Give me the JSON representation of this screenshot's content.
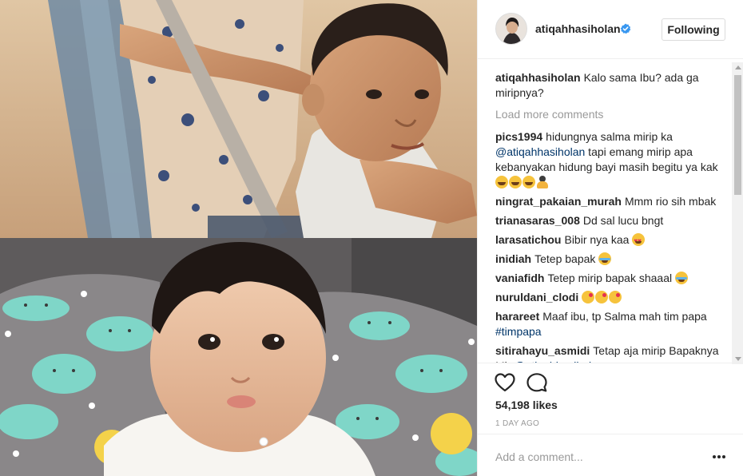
{
  "post": {
    "author": "atiqahhasiholan",
    "follow_label": "Following",
    "caption": "Kalo sama Ibu? ada ga miripnya?",
    "load_more_label": "Load more comments",
    "likes": "54,198 likes",
    "time": "1 DAY AGO",
    "comment_placeholder": "Add a comment..."
  },
  "comments": [
    {
      "user": "pics1994",
      "parts": [
        {
          "t": "hidungnya salma mirip ka "
        },
        {
          "t": "@atiqahhasiholan",
          "m": true
        },
        {
          "t": " tapi emang mirip apa kebanyakan hidung bayi masih begitu ya kak "
        }
      ],
      "emoji": [
        "laugh",
        "laugh",
        "laugh",
        "pray"
      ]
    },
    {
      "user": "ningrat_pakaian_murah",
      "parts": [
        {
          "t": "Mmm rio sih mbak"
        }
      ],
      "emoji": []
    },
    {
      "user": "trianasaras_008",
      "parts": [
        {
          "t": "Dd sal lucu bngt"
        }
      ],
      "emoji": []
    },
    {
      "user": "larasatichou",
      "parts": [
        {
          "t": "Bibir nya kaa "
        }
      ],
      "emoji": [
        "heart-eyes"
      ]
    },
    {
      "user": "inidiah",
      "parts": [
        {
          "t": "Tetep bapak "
        }
      ],
      "emoji": [
        "grin-tears"
      ]
    },
    {
      "user": "vaniafidh",
      "parts": [
        {
          "t": "Tetep mirip bapak shaaal "
        }
      ],
      "emoji": [
        "grin-tears"
      ]
    },
    {
      "user": "nuruldani_clodi",
      "parts": [
        {
          "t": ""
        }
      ],
      "emoji": [
        "kiss",
        "kiss",
        "kiss"
      ]
    },
    {
      "user": "harareet",
      "parts": [
        {
          "t": "Maaf ibu, tp Salma mah tim papa "
        },
        {
          "t": "#timpapa",
          "m": true
        }
      ],
      "emoji": []
    },
    {
      "user": "sitirahayu_asmidi",
      "parts": [
        {
          "t": "Tetap aja mirip Bapaknya Mb "
        },
        {
          "t": "@atiqahhasiholan",
          "m": true
        }
      ],
      "emoji": []
    }
  ],
  "icons": {
    "avatar": "profile-photo",
    "verified": "verified-badge-icon",
    "like": "heart-icon",
    "comment": "comment-bubble-icon",
    "more": "more-options-icon"
  },
  "colors": {
    "text": "#262626",
    "muted": "#999999",
    "link": "#003569",
    "verified": "#3897f0",
    "border": "#efefef"
  }
}
